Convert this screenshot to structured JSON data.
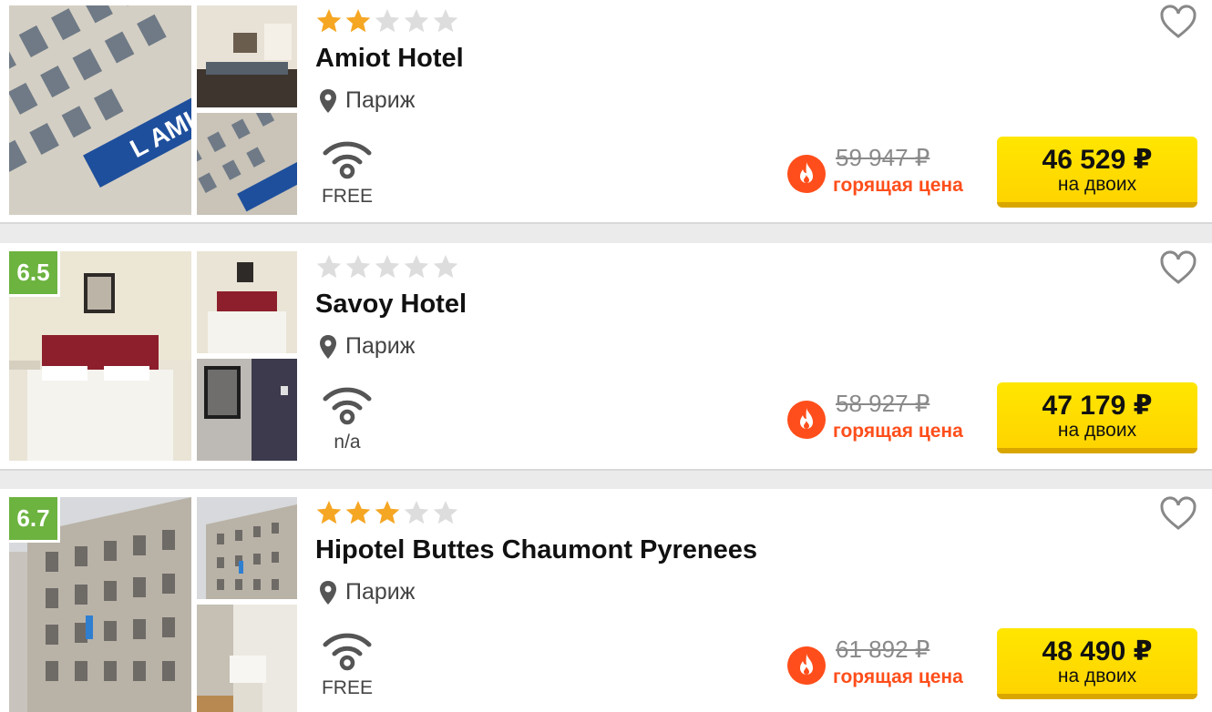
{
  "currency_color": "#111111",
  "colors": {
    "accent_yellow": "#ffd400",
    "hot_orange": "#ff4e1b",
    "rating_green": "#6cb33f",
    "star_filled": "#f5a623",
    "star_empty": "#dddddd"
  },
  "icons": {
    "location": "map-pin-icon",
    "wifi": "wifi-icon",
    "hot": "flame-icon",
    "favorite": "heart-outline-icon",
    "star": "star-icon"
  },
  "hotels": [
    {
      "name": "Amiot Hotel",
      "stars": 2,
      "rating": "",
      "city": "Париж",
      "wifi": "FREE",
      "old_price": "59 947 ₽",
      "hot_label": "горящая цена",
      "price": "46 529 ₽",
      "price_note": "на двоих"
    },
    {
      "name": "Savoy Hotel",
      "stars": 0,
      "rating": "6.5",
      "city": "Париж",
      "wifi": "n/a",
      "old_price": "58 927 ₽",
      "hot_label": "горящая цена",
      "price": "47 179 ₽",
      "price_note": "на двоих"
    },
    {
      "name": "Hipotel Buttes Chaumont Pyrenees",
      "stars": 3,
      "rating": "6.7",
      "city": "Париж",
      "wifi": "FREE",
      "old_price": "61 892 ₽",
      "hot_label": "горящая цена",
      "price": "48 490 ₽",
      "price_note": "на двоих"
    }
  ]
}
